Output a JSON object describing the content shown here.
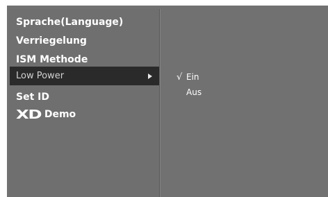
{
  "menu": {
    "items": [
      {
        "label": "Sprache(Language)"
      },
      {
        "label": "Verriegelung"
      },
      {
        "label": "ISM Methode"
      },
      {
        "label": "Low Power"
      },
      {
        "label": "Set ID"
      },
      {
        "logo": "XD",
        "label": "Demo"
      }
    ],
    "selected_index": 3
  },
  "submenu": {
    "options": [
      {
        "label": "Ein",
        "checked": true,
        "check_mark": "√"
      },
      {
        "label": "Aus",
        "checked": false
      }
    ]
  },
  "icons": {
    "submenu_arrow": "arrow-right-icon",
    "check": "check-icon"
  },
  "colors": {
    "panel_background": "#717171",
    "selected_row": "#2a2a2a",
    "text": "#ffffff"
  }
}
